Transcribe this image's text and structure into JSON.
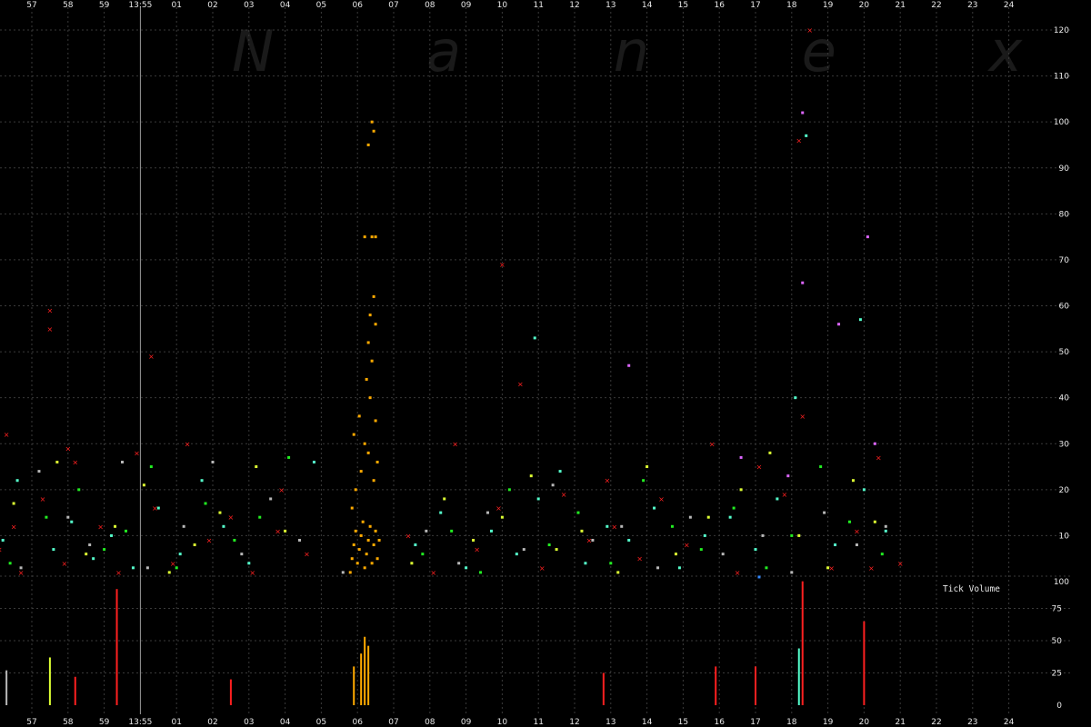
{
  "watermark": "N a n e x",
  "volume_label": "Tick Volume",
  "colors": {
    "background": "#000000",
    "grid": "#3a3a3a",
    "cursor_line": "#9a9a9a",
    "trade_red": "#ff2020",
    "trade_aqua": "#55ffcc",
    "trade_green": "#22ee22",
    "trade_yellow": "#ddff33",
    "trade_grey": "#b8b8b8",
    "trade_orange": "#ffaa00",
    "trade_violet": "#dd66ff",
    "trade_blue": "#3388ff"
  },
  "chart_data": [
    {
      "type": "scatter",
      "title": "",
      "xlabel": "",
      "ylabel": "",
      "x_ticks": [
        "57",
        "58",
        "59",
        "13:55",
        "01",
        "02",
        "03",
        "04",
        "05",
        "06",
        "07",
        "08",
        "09",
        "10",
        "11",
        "12",
        "13",
        "14",
        "15",
        "16",
        "17",
        "18",
        "19",
        "20",
        "21",
        "22",
        "23",
        "24"
      ],
      "cursor_tick": "13:55",
      "y_ticks": [
        0,
        10,
        20,
        30,
        40,
        50,
        60,
        70,
        80,
        90,
        100,
        110,
        120
      ],
      "y_tick_labels": [
        "100",
        "10",
        "20",
        "30",
        "40",
        "50",
        "60",
        "70",
        "80",
        "90",
        "100",
        "110",
        "120"
      ],
      "ylim": [
        0,
        122
      ],
      "grid": true,
      "series": [
        {
          "color": "orange",
          "x": [
            8.8,
            8.85,
            8.9,
            8.95,
            9.0,
            9.05,
            9.1,
            9.15,
            9.2,
            9.25,
            9.3,
            9.35,
            9.4,
            9.45,
            9.5,
            9.55,
            9.6,
            8.85,
            8.95,
            9.1,
            9.3,
            9.45,
            9.55,
            8.9,
            9.05,
            9.2,
            9.35,
            9.5,
            9.25,
            9.4,
            9.3,
            9.5,
            9.35,
            9.45,
            9.4,
            9.5,
            9.2,
            9.3,
            9.4,
            9.45
          ],
          "y": [
            2,
            5,
            8,
            11,
            4,
            7,
            10,
            13,
            3,
            6,
            9,
            12,
            4,
            8,
            11,
            5,
            9,
            16,
            20,
            24,
            28,
            22,
            26,
            32,
            36,
            30,
            40,
            35,
            44,
            48,
            52,
            56,
            58,
            62,
            75,
            75,
            75,
            95,
            100,
            98
          ]
        },
        {
          "color": "red",
          "x": [
            -0.9,
            -0.7,
            -0.5,
            -0.3,
            0.3,
            0.5,
            0.9,
            1.2,
            1.9,
            2.4,
            2.9,
            3.4,
            3.9,
            4.3,
            4.9,
            5.5,
            6.1,
            6.9,
            7.6,
            10.4,
            11.1,
            11.7,
            12.3,
            12.9,
            13.5,
            14.1,
            14.7,
            15.4,
            16.1,
            16.8,
            17.4,
            18.1,
            18.8,
            19.5,
            20.1,
            20.8,
            21.2,
            21.5,
            22.1,
            22.8,
            23.4,
            24.0,
            0.5,
            3.3,
            6.8,
            13.0,
            15.9,
            21.3,
            23.2,
            1.0
          ],
          "y": [
            7,
            32,
            12,
            2,
            18,
            59,
            4,
            26,
            12,
            2,
            28,
            16,
            4,
            30,
            9,
            14,
            2,
            20,
            6,
            10,
            2,
            30,
            7,
            16,
            43,
            3,
            19,
            9,
            12,
            5,
            18,
            8,
            30,
            2,
            25,
            19,
            96,
            120,
            3,
            11,
            27,
            4,
            55,
            49,
            11,
            69,
            22,
            36,
            3,
            29
          ]
        },
        {
          "color": "aqua",
          "x": [
            -0.8,
            -0.4,
            0.6,
            1.1,
            1.7,
            2.2,
            2.8,
            3.5,
            4.1,
            4.7,
            5.3,
            6.0,
            7.8,
            10.6,
            11.3,
            12.0,
            12.7,
            13.4,
            14.0,
            14.6,
            15.3,
            15.9,
            16.5,
            17.2,
            17.9,
            18.6,
            19.3,
            20.0,
            20.6,
            21.4,
            22.2,
            22.9,
            23.6,
            21.1,
            23.0,
            13.9
          ],
          "y": [
            9,
            22,
            7,
            13,
            5,
            10,
            3,
            16,
            6,
            22,
            12,
            4,
            26,
            8,
            15,
            3,
            11,
            6,
            18,
            24,
            4,
            12,
            9,
            16,
            3,
            10,
            14,
            7,
            18,
            97,
            8,
            57,
            11,
            40,
            20,
            53
          ]
        },
        {
          "color": "green",
          "x": [
            -0.6,
            0.4,
            1.3,
            2.0,
            2.6,
            3.3,
            4.0,
            4.8,
            5.6,
            6.3,
            7.1,
            10.8,
            11.6,
            12.4,
            13.2,
            14.3,
            15.1,
            16.0,
            16.9,
            17.7,
            18.5,
            19.4,
            20.3,
            21.0,
            21.8,
            22.6,
            23.5
          ],
          "y": [
            4,
            14,
            20,
            7,
            11,
            25,
            3,
            17,
            9,
            14,
            27,
            6,
            11,
            2,
            20,
            8,
            15,
            4,
            22,
            12,
            7,
            16,
            3,
            10,
            25,
            13,
            6
          ]
        },
        {
          "color": "yellow",
          "x": [
            -0.5,
            0.7,
            1.5,
            2.3,
            3.1,
            3.8,
            4.5,
            5.2,
            6.2,
            7.0,
            10.5,
            11.4,
            12.2,
            13.0,
            13.8,
            14.5,
            15.2,
            16.2,
            17.0,
            17.8,
            18.7,
            19.6,
            20.4,
            21.2,
            22.0,
            22.7,
            23.3
          ],
          "y": [
            17,
            26,
            6,
            12,
            21,
            2,
            8,
            15,
            25,
            11,
            4,
            18,
            9,
            14,
            23,
            7,
            11,
            2,
            25,
            6,
            14,
            20,
            28,
            10,
            3,
            22,
            13
          ]
        },
        {
          "color": "grey",
          "x": [
            -0.3,
            0.2,
            1.0,
            1.6,
            2.5,
            3.2,
            4.2,
            5.0,
            5.8,
            6.6,
            7.4,
            8.6,
            10.9,
            11.8,
            12.6,
            13.6,
            14.4,
            15.5,
            16.3,
            17.3,
            18.2,
            19.1,
            20.2,
            21.0,
            21.9,
            22.8,
            23.6
          ],
          "y": [
            3,
            24,
            14,
            8,
            26,
            3,
            12,
            26,
            6,
            18,
            9,
            2,
            11,
            4,
            15,
            7,
            21,
            9,
            12,
            3,
            14,
            6,
            10,
            2,
            15,
            8,
            12
          ]
        },
        {
          "color": "violet",
          "x": [
            21.3,
            22.3,
            23.1,
            23.3,
            16.5,
            19.6,
            20.9,
            21.3
          ],
          "y": [
            65,
            56,
            75,
            30,
            47,
            27,
            23,
            102
          ]
        },
        {
          "color": "blue",
          "x": [
            20.1
          ],
          "y": [
            1
          ]
        }
      ]
    },
    {
      "type": "bar",
      "title": "Tick Volume",
      "ylabel": "",
      "y_ticks": [
        0,
        25,
        50,
        75,
        100
      ],
      "ylim": [
        0,
        100
      ],
      "grid": true,
      "spikes": [
        {
          "x": 2.35,
          "value": 90,
          "color": "red"
        },
        {
          "x": 0.5,
          "value": 37,
          "color": "yellow"
        },
        {
          "x": -0.7,
          "value": 27,
          "color": "grey"
        },
        {
          "x": 1.2,
          "value": 22,
          "color": "red"
        },
        {
          "x": 5.5,
          "value": 20,
          "color": "red"
        },
        {
          "x": 21.3,
          "value": 96,
          "color": "red"
        },
        {
          "x": 21.2,
          "value": 44,
          "color": "aqua"
        },
        {
          "x": 23.0,
          "value": 65,
          "color": "red"
        },
        {
          "x": 9.2,
          "value": 53,
          "color": "orange"
        },
        {
          "x": 9.1,
          "value": 40,
          "color": "orange"
        },
        {
          "x": 9.3,
          "value": 46,
          "color": "orange"
        },
        {
          "x": 8.9,
          "value": 30,
          "color": "orange"
        },
        {
          "x": 20.0,
          "value": 30,
          "color": "red"
        },
        {
          "x": 15.8,
          "value": 25,
          "color": "red"
        },
        {
          "x": 18.9,
          "value": 30,
          "color": "red"
        }
      ]
    }
  ]
}
